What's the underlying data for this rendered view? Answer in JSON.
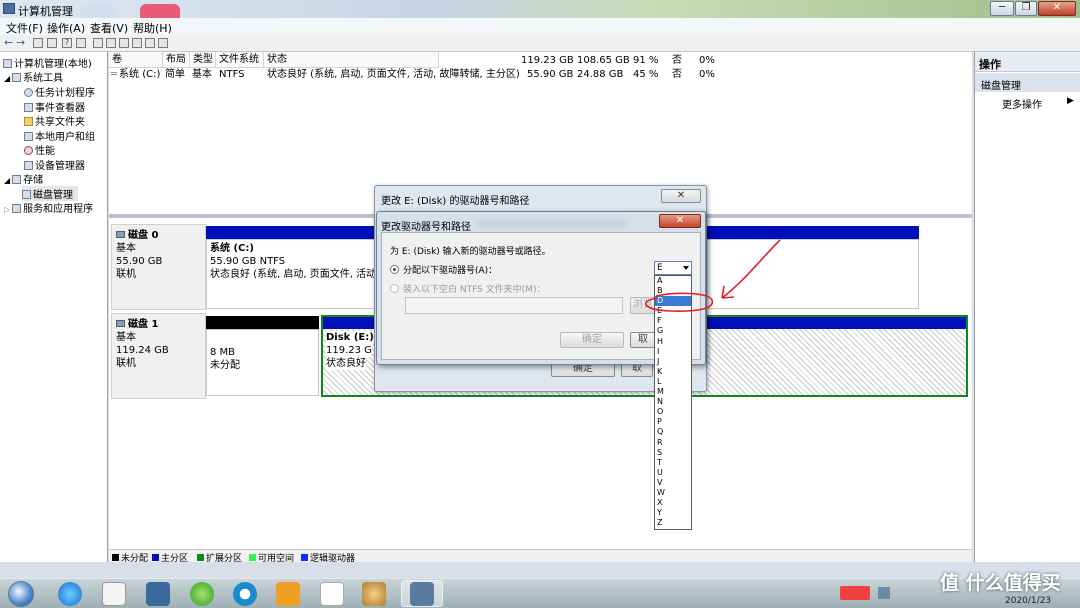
{
  "window": {
    "title": "计算机管理",
    "minimize": "─",
    "maximize": "❐",
    "close": "✕"
  },
  "menu": {
    "file": "文件(F)",
    "action": "操作(A)",
    "view": "查看(V)",
    "help": "帮助(H)"
  },
  "toolbar": {
    "back": "←",
    "forward": "→",
    "help": "?"
  },
  "tree": {
    "root": "计算机管理(本地)",
    "system_tools": "系统工具",
    "task_scheduler": "任务计划程序",
    "event_viewer": "事件查看器",
    "shared_folders": "共享文件夹",
    "local_users": "本地用户和组",
    "performance": "性能",
    "device_manager": "设备管理器",
    "storage": "存储",
    "disk_management": "磁盘管理",
    "services_apps": "服务和应用程序"
  },
  "volume_list": {
    "headers": {
      "volume": "卷",
      "layout": "布局",
      "type": "类型",
      "fs": "文件系统",
      "status": "状态"
    },
    "rows": [
      {
        "volume": "",
        "layout": "",
        "type": "",
        "fs": "",
        "status": "",
        "capacity": "119.23 GB",
        "free": "108.65 GB",
        "pct": "91 %",
        "fault": "否",
        "overhead": "0%"
      },
      {
        "volume": "系统 (C:)",
        "layout": "简单",
        "type": "基本",
        "fs": "NTFS",
        "status": "状态良好 (系统, 启动, 页面文件, 活动, 故障转储, 主分区)",
        "capacity": "55.90 GB",
        "free": "24.88 GB",
        "pct": "45 %",
        "fault": "否",
        "overhead": "0%"
      }
    ]
  },
  "disks": {
    "disk0": {
      "name": "磁盘 0",
      "type": "基本",
      "size": "55.90 GB",
      "state": "联机",
      "part_name": "系统 (C:)",
      "part_size": "55.90 GB NTFS",
      "part_status": "状态良好 (系统, 启动, 页面文件, 活动"
    },
    "disk1": {
      "name": "磁盘 1",
      "type": "基本",
      "size": "119.24 GB",
      "state": "联机",
      "unalloc_size": "8 MB",
      "unalloc_label": "未分配",
      "part_name": "Disk (E:)",
      "part_size": "119.23 G",
      "part_status": "状态良好"
    }
  },
  "legend": {
    "unallocated": "未分配",
    "primary": "主分区",
    "extended": "扩展分区",
    "free_space": "可用空间",
    "logical": "逻辑驱动器"
  },
  "actions": {
    "header": "操作",
    "section": "磁盘管理",
    "more": "更多操作",
    "more_arrow": "▶"
  },
  "outer_dialog": {
    "title": "更改 E: (Disk) 的驱动器号和路径",
    "close": "✕",
    "ok": "确定",
    "cancel": "取"
  },
  "inner_dialog": {
    "title": "更改驱动器号和路径",
    "close": "✕",
    "prompt": "为 E: (Disk) 输入新的驱动器号或路径。",
    "option_assign": "分配以下驱动器号(A)：",
    "option_mount": "装入以下空白 NTFS 文件夹中(M)：",
    "browse": "浏览",
    "ok": "确定",
    "cancel": "取"
  },
  "drive_select": {
    "value": "E",
    "highlighted": "D",
    "options": [
      "A",
      "B",
      "D",
      "E",
      "F",
      "G",
      "H",
      "I",
      "J",
      "K",
      "L",
      "M",
      "N",
      "O",
      "P",
      "Q",
      "R",
      "S",
      "T",
      "U",
      "V",
      "W",
      "X",
      "Y",
      "Z"
    ]
  },
  "annotation": {
    "color": "#e0202a"
  },
  "taskbar": {
    "time": "",
    "date": "2020/1/23"
  },
  "watermark": "值 什么值得买"
}
